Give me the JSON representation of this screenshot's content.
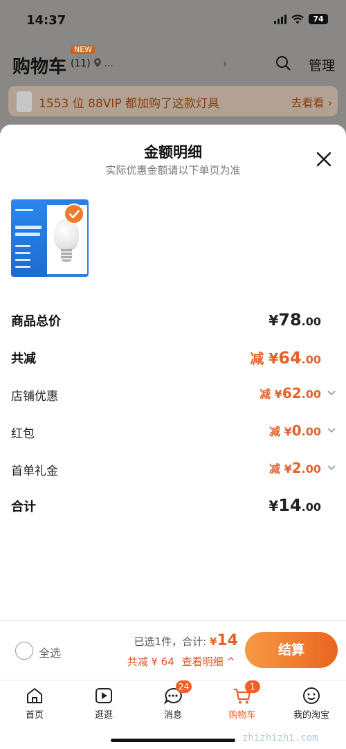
{
  "status_bar": {
    "time": "14:37",
    "battery": "74"
  },
  "cart_header": {
    "title": "购物车",
    "count": "(11)",
    "new_badge": "NEW",
    "location": "...",
    "manage": "管理"
  },
  "promo": {
    "text": "1553 位 88VIP 都加购了这款灯具",
    "link": "去看看 ›"
  },
  "modal": {
    "title": "金额明细",
    "subtitle": "实际优惠金额请以下单页为准"
  },
  "rows": [
    {
      "label": "商品总价",
      "currency": "¥",
      "int": "78",
      "dec": ".00",
      "prefix": "",
      "color": "black",
      "expandable": false,
      "bold": true
    },
    {
      "label": "共减",
      "currency": "¥",
      "int": "64",
      "dec": ".00",
      "prefix": "减 ",
      "color": "orange",
      "expandable": false,
      "bold": true
    },
    {
      "label": "店铺优惠",
      "currency": "¥",
      "int": "62",
      "dec": ".00",
      "prefix": "减 ",
      "color": "orange",
      "expandable": true,
      "bold": false
    },
    {
      "label": "红包",
      "currency": "¥",
      "int": "0",
      "dec": ".00",
      "prefix": "减 ",
      "color": "orange",
      "expandable": true,
      "bold": false
    },
    {
      "label": "首单礼金",
      "currency": "¥",
      "int": "2",
      "dec": ".00",
      "prefix": "减 ",
      "color": "orange",
      "expandable": true,
      "bold": false
    },
    {
      "label": "合计",
      "currency": "¥",
      "int": "14",
      "dec": ".00",
      "prefix": "",
      "color": "black",
      "expandable": false,
      "bold": true
    }
  ],
  "checkout": {
    "select_all": "全选",
    "selected": "已选1件，",
    "total_label": "合计:",
    "total_currency": "¥",
    "total_value": "14",
    "discount_text": "共减 ¥ 64",
    "details_link": "查看明细 ^",
    "button": "结算"
  },
  "tabs": [
    {
      "label": "首页",
      "icon": "home-icon",
      "badge": ""
    },
    {
      "label": "逛逛",
      "icon": "play-icon",
      "badge": ""
    },
    {
      "label": "消息",
      "icon": "message-icon",
      "badge": "24"
    },
    {
      "label": "购物车",
      "icon": "cart-icon",
      "badge": "1"
    },
    {
      "label": "我的淘宝",
      "icon": "profile-icon",
      "badge": ""
    }
  ],
  "watermark": "zhizhizhi.com",
  "colors": {
    "accent": "#e2622a",
    "button_start": "#f59a44",
    "button_end": "#ea6520"
  }
}
